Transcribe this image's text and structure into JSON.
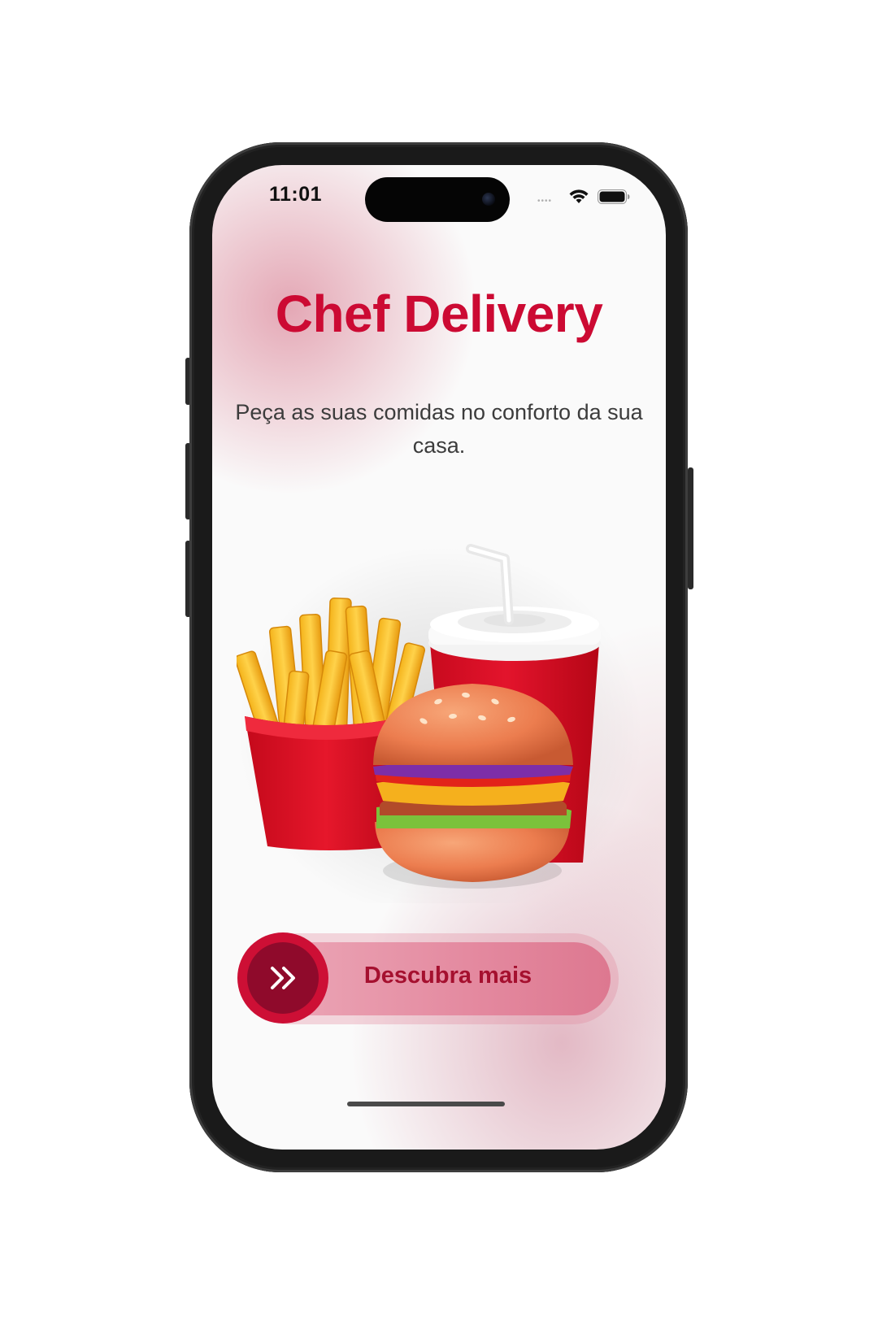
{
  "status_bar": {
    "time": "11:01",
    "signal_dots": "••••",
    "wifi_icon": "wifi-icon",
    "battery_icon": "battery-icon"
  },
  "app": {
    "title": "Chef Delivery",
    "subtitle": "Peça as suas comidas no conforto da sua casa.",
    "hero_image_icon": "burger-fries-soda-illustration"
  },
  "slider": {
    "label": "Descubra mais",
    "icon": "chevrons-right-icon"
  },
  "colors": {
    "brand": "#cc0a33",
    "knob_inner": "#8f0a2b",
    "slider_label": "#a5102f"
  }
}
